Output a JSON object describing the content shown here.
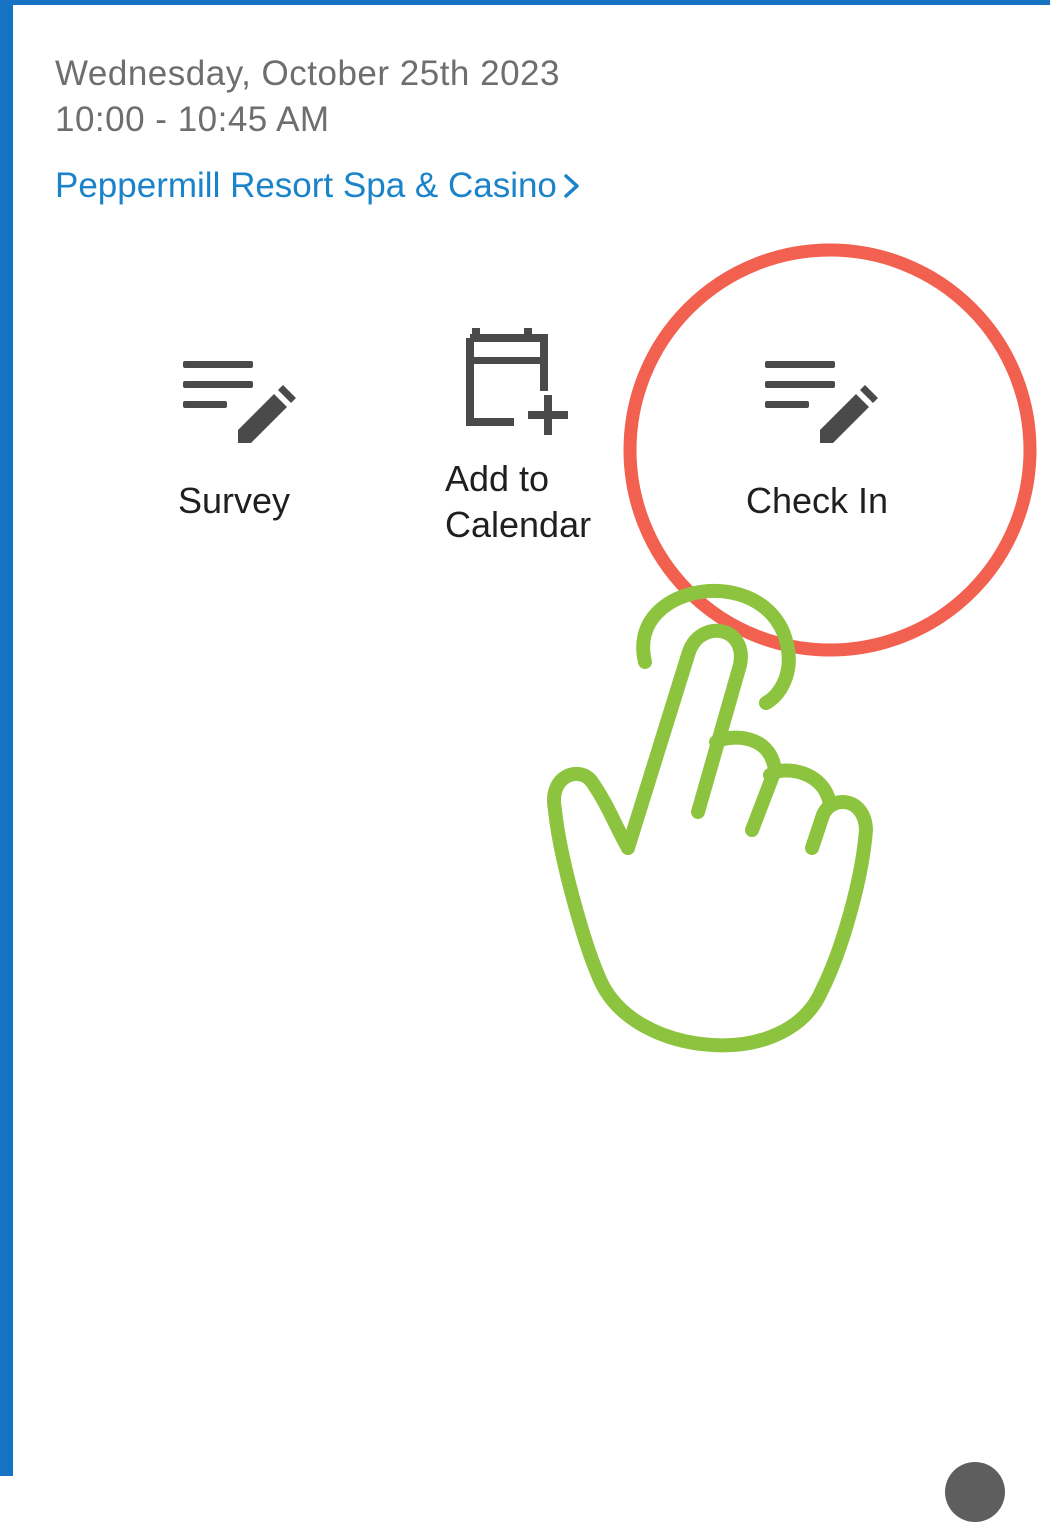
{
  "event": {
    "date": "Wednesday, October 25th 2023",
    "time": "10:00 - 10:45 AM",
    "venue": "Peppermill Resort Spa & Casino"
  },
  "actions": [
    {
      "label": "Survey",
      "icon": "survey-edit-icon"
    },
    {
      "label": "Add to\nCalendar",
      "icon": "calendar-add-icon"
    },
    {
      "label": "Check In",
      "icon": "check-in-edit-icon"
    }
  ],
  "annotation": {
    "highlight_color": "#f2604f",
    "pointer_color": "#8cc43f",
    "highlighted_action": "Check In"
  },
  "colors": {
    "frame": "#1673c4",
    "link": "#1a83c9",
    "secondary_text": "#6e6e6e",
    "icon": "#4a4a4a"
  }
}
